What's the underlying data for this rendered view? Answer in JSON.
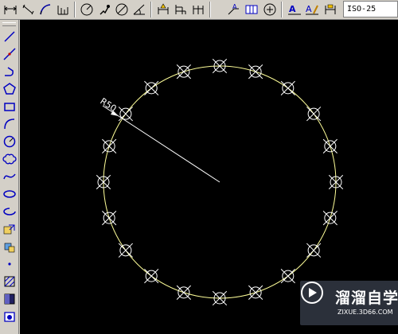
{
  "toolbar": {
    "dimension_style": "ISO-25",
    "buttons": [
      "linear-dimension-icon",
      "aligned-dimension-icon",
      "arc-length-icon",
      "ordinate-dimension-icon",
      "radius-dimension-icon",
      "jogged-dimension-icon",
      "diameter-dimension-icon",
      "angular-dimension-icon",
      "quick-dimension-icon",
      "baseline-dimension-icon",
      "continue-dimension-icon",
      "quick-leader-icon",
      "tolerance-icon",
      "center-mark-icon",
      "dimension-edit-icon",
      "dimension-text-edit-icon",
      "dimension-update-icon"
    ]
  },
  "side_toolbar": {
    "buttons": [
      "line-icon",
      "construction-line-icon",
      "polyline-icon",
      "polygon-icon",
      "rectangle-icon",
      "arc-icon",
      "circle-icon",
      "revision-cloud-icon",
      "spline-icon",
      "ellipse-icon",
      "ellipse-arc-icon",
      "insert-block-icon",
      "make-block-icon",
      "point-icon",
      "hatch-icon",
      "gradient-icon",
      "region-icon"
    ]
  },
  "drawing": {
    "dimension_text": "R50",
    "circle_color": "#ffff99",
    "marker_count": 20,
    "background": "#000000"
  },
  "watermark": {
    "title": "溜溜自学",
    "url": "ZIXUE.3D66.COM"
  }
}
